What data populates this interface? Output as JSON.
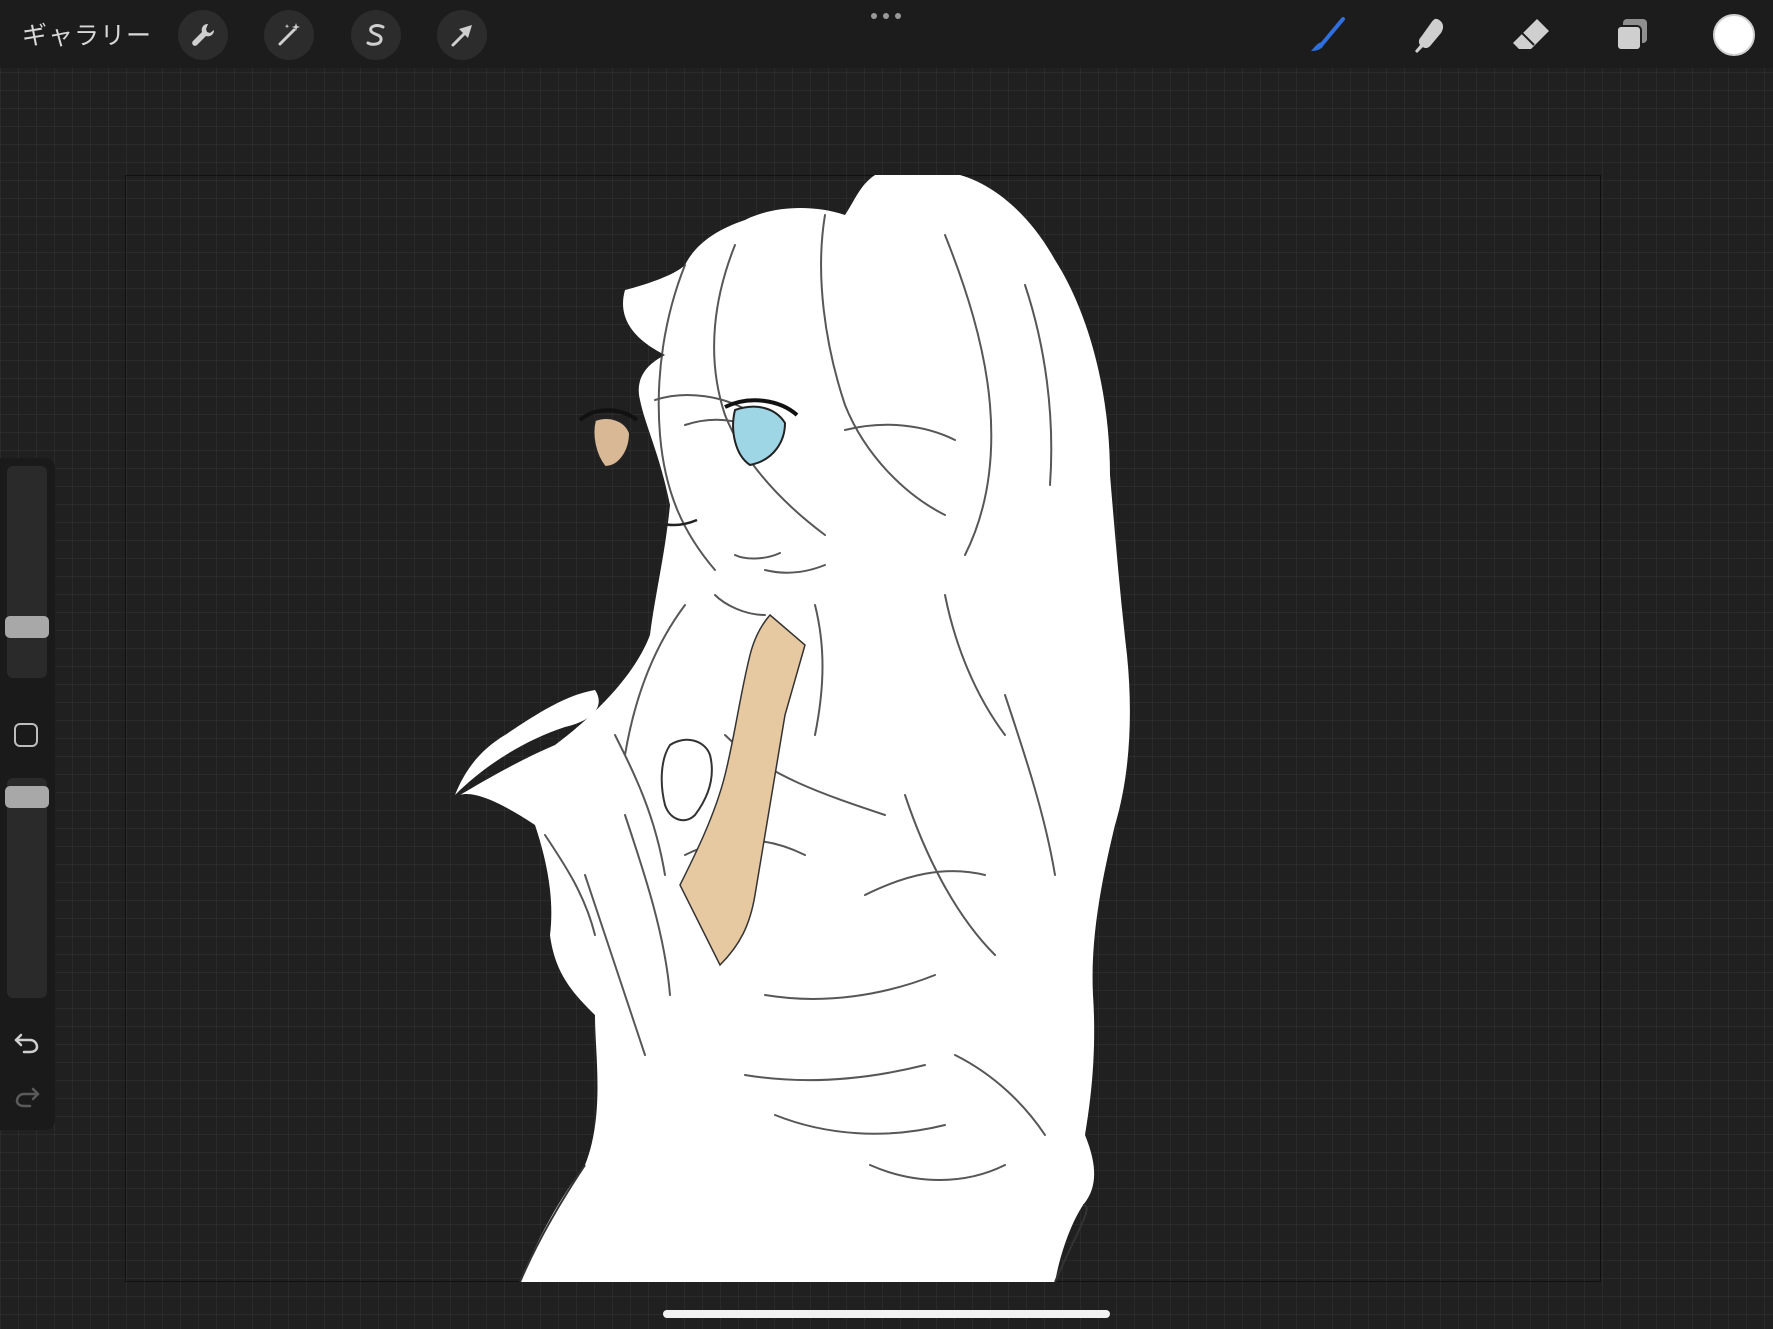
{
  "topbar": {
    "gallery_label": "ギャラリー",
    "left_tools": [
      {
        "name": "actions",
        "icon": "wrench-icon"
      },
      {
        "name": "adjustments",
        "icon": "magic-wand-icon"
      },
      {
        "name": "selection",
        "icon": "selection-s-icon"
      },
      {
        "name": "transform",
        "icon": "arrow-cursor-icon"
      }
    ],
    "more_icon": "ellipsis-icon",
    "right_tools": [
      {
        "name": "brush",
        "icon": "brush-icon",
        "active": true
      },
      {
        "name": "smudge",
        "icon": "smudge-finger-icon",
        "active": false
      },
      {
        "name": "eraser",
        "icon": "eraser-icon",
        "active": false
      },
      {
        "name": "layers",
        "icon": "layers-icon",
        "active": false
      }
    ],
    "current_color": "#ffffff"
  },
  "sidebar": {
    "brush_size_level": 0.21,
    "opacity_level": 0.96,
    "undo_icon": "undo-icon",
    "redo_icon": "redo-icon"
  },
  "colors": {
    "accent": "#2f6fe0",
    "background": "#202020",
    "tie": "#e6c9a0",
    "right_eye": "#9fd6e6",
    "left_eye": "#d9b896"
  }
}
